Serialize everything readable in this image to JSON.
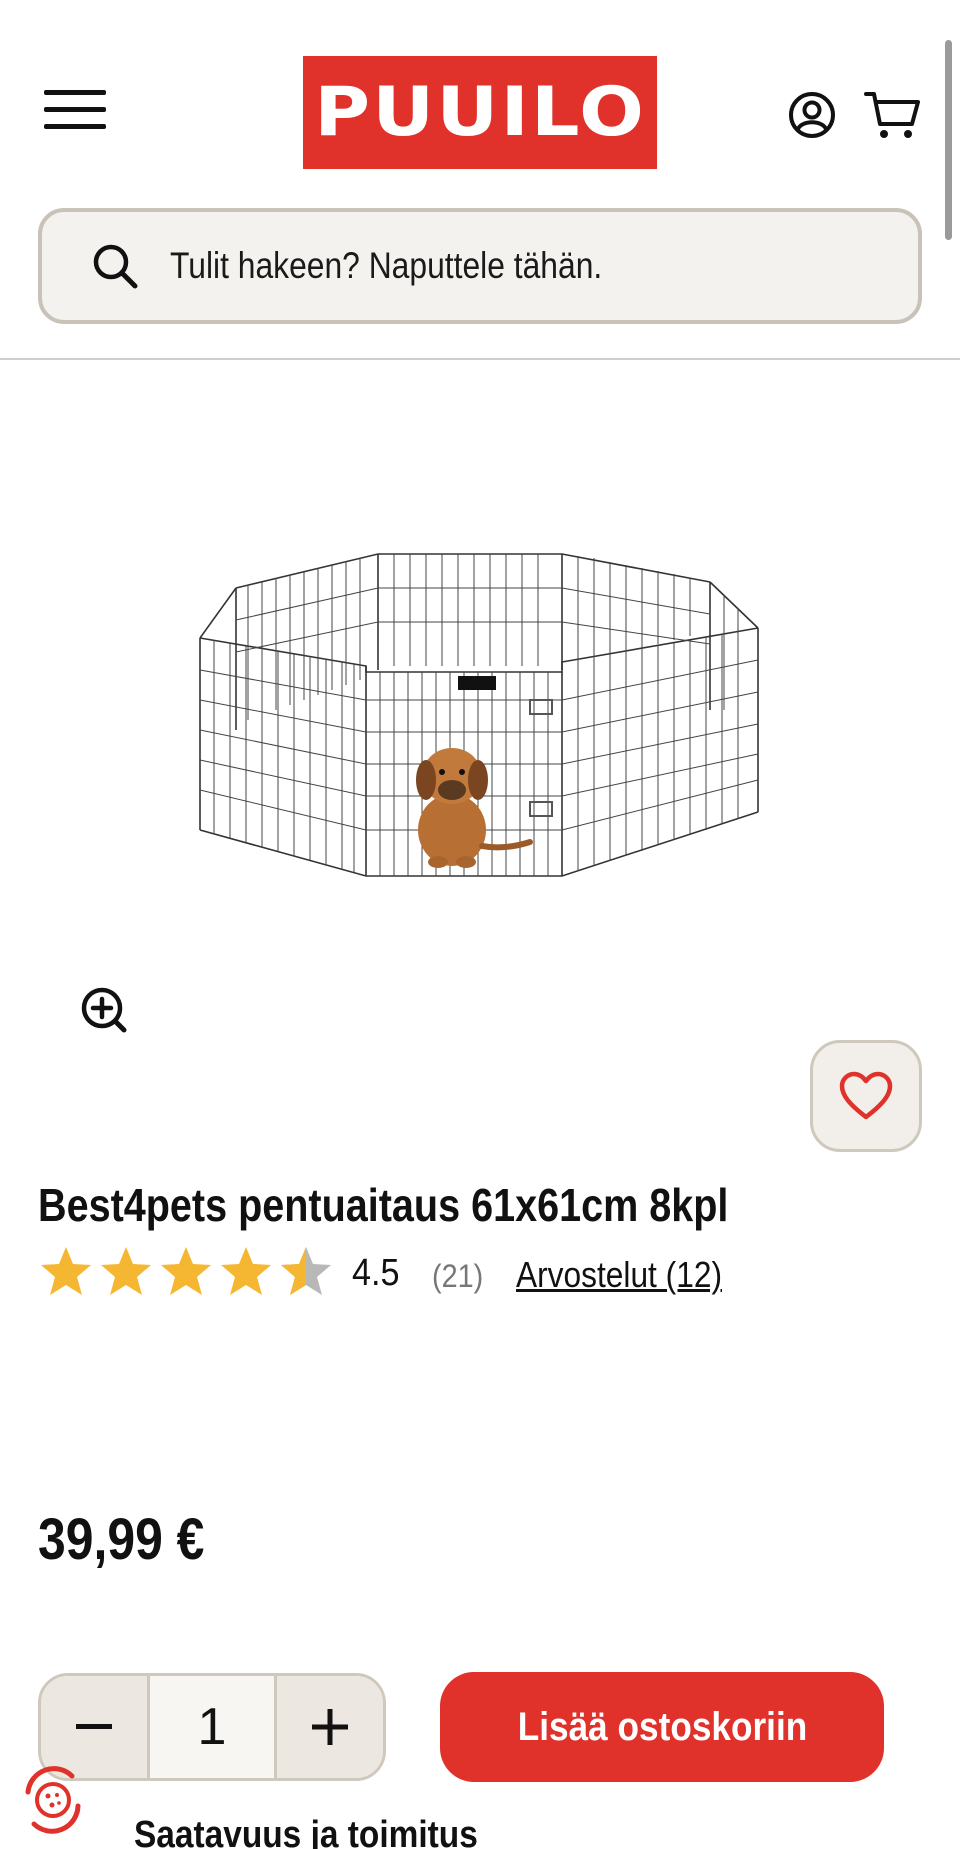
{
  "header": {
    "logo_text": "PUUILO",
    "search_placeholder": "Tulit hakeen? Naputtele tähän."
  },
  "product": {
    "title": "Best4pets pentuaitaus 61x61cm 8kpl",
    "rating": 4.5,
    "rating_display": "4.5",
    "rating_count": "(21)",
    "reviews_link": "Arvostelut (12)",
    "price": "39,99 €",
    "quantity": "1",
    "image_label": "Best4pets"
  },
  "actions": {
    "add_to_cart": "Lisää ostoskoriin"
  },
  "availability": {
    "heading": "Saatavuus ja toimitus"
  },
  "colors": {
    "brand_red": "#e0312a",
    "star": "#f5b731",
    "star_empty": "#b8b8b8",
    "beige": "#f4f2ee"
  },
  "icons": [
    "menu-icon",
    "account-icon",
    "cart-icon",
    "search-icon",
    "zoom-in-icon",
    "heart-icon",
    "minus-icon",
    "plus-icon",
    "cookie-icon"
  ]
}
